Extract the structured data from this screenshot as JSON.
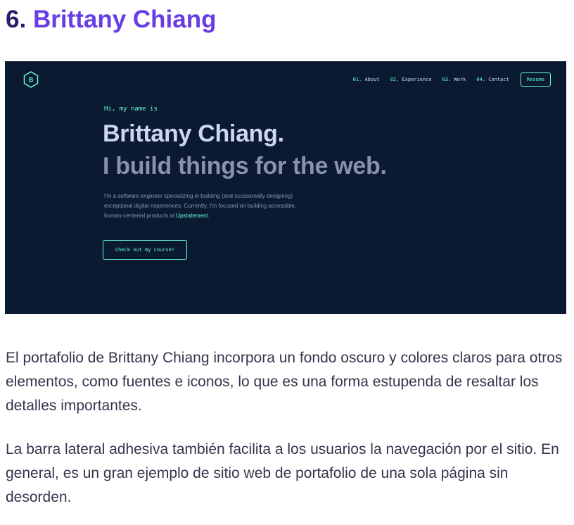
{
  "heading": {
    "number": "6.",
    "name": "Brittany Chiang"
  },
  "screenshot": {
    "logo_letter": "B",
    "nav": [
      {
        "num": "01.",
        "label": "About"
      },
      {
        "num": "02.",
        "label": "Experience"
      },
      {
        "num": "03.",
        "label": "Work"
      },
      {
        "num": "04.",
        "label": "Contact"
      }
    ],
    "resume_label": "Resume",
    "greeting": "Hi, my name is",
    "name": "Brittany Chiang.",
    "tagline": "I build things for the web.",
    "description_pre": "I'm a software engineer specializing in building (and occasionally designing) exceptional digital experiences. Currently, I'm focused on building accessible, human-centered products at ",
    "description_link": "Upstatement",
    "description_post": ".",
    "cta_label": "Check out my course!",
    "colors": {
      "background": "#0b1a30",
      "accent": "#64ffda",
      "heading_text": "#ccd6f6",
      "body_text": "#8892b0"
    }
  },
  "paragraphs": [
    "El portafolio de Brittany Chiang incorpora un fondo oscuro y colores claros para otros elementos, como fuentes e iconos, lo que es una forma estupenda de resaltar los detalles importantes.",
    "La barra lateral adhesiva también facilita a los usuarios la navegación por el sitio. En general, es un gran ejemplo de sitio web de portafolio de una sola página sin desorden."
  ]
}
